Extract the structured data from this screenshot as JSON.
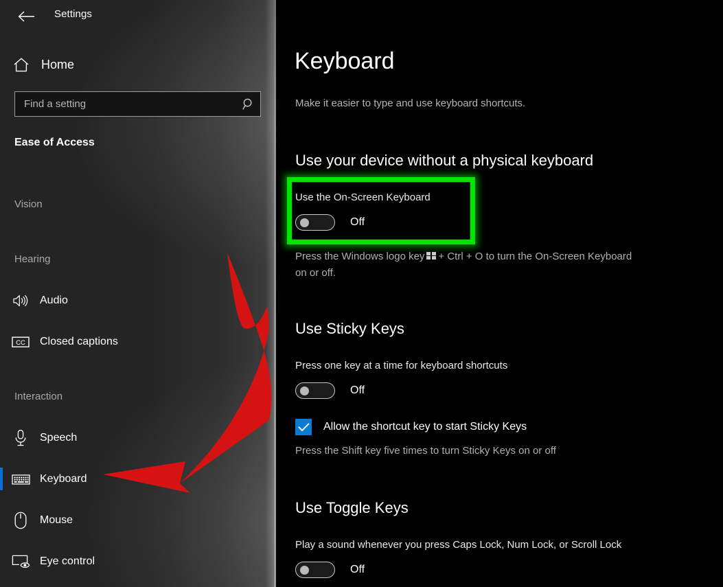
{
  "window": {
    "title": "Settings",
    "back_icon": "back-arrow-icon"
  },
  "sidebar": {
    "home": {
      "label": "Home",
      "icon": "home-icon"
    },
    "search": {
      "placeholder": "Find a setting",
      "value": "",
      "icon": "search-icon"
    },
    "category": "Ease of Access",
    "groups": [
      {
        "label": "Vision",
        "items": []
      },
      {
        "label": "Hearing",
        "items": [
          {
            "label": "Audio",
            "icon": "speaker-icon",
            "selected": false
          },
          {
            "label": "Closed captions",
            "icon": "closed-caption-icon",
            "selected": false
          }
        ]
      },
      {
        "label": "Interaction",
        "items": [
          {
            "label": "Speech",
            "icon": "microphone-icon",
            "selected": false
          },
          {
            "label": "Keyboard",
            "icon": "keyboard-icon",
            "selected": true
          },
          {
            "label": "Mouse",
            "icon": "mouse-icon",
            "selected": false
          },
          {
            "label": "Eye control",
            "icon": "eye-control-icon",
            "selected": false
          }
        ]
      }
    ]
  },
  "main": {
    "title": "Keyboard",
    "subtitle": "Make it easier to type and use keyboard shortcuts.",
    "sections": [
      {
        "heading": "Use your device without a physical keyboard",
        "setting_label": "Use the On-Screen Keyboard",
        "toggle_state": "Off",
        "hint_before": "Press the Windows logo key",
        "hint_after": "+ Ctrl + O to turn the On-Screen Keyboard on or off.",
        "highlighted": true
      },
      {
        "heading": "Use Sticky Keys",
        "setting_label": "Press one key at a time for keyboard shortcuts",
        "toggle_state": "Off",
        "checkbox_label": "Allow the shortcut key to start Sticky Keys",
        "checkbox_checked": true,
        "hint": "Press the Shift key five times to turn Sticky Keys on or off"
      },
      {
        "heading": "Use Toggle Keys",
        "setting_label": "Play a sound whenever you press Caps Lock, Num Lock, or Scroll Lock",
        "toggle_state": "Off"
      }
    ]
  },
  "annotations": {
    "highlight_color": "#00e400",
    "arrow_color": "#d61313",
    "selection_color": "#0a6fd8",
    "accent_color": "#0a7bd4"
  }
}
